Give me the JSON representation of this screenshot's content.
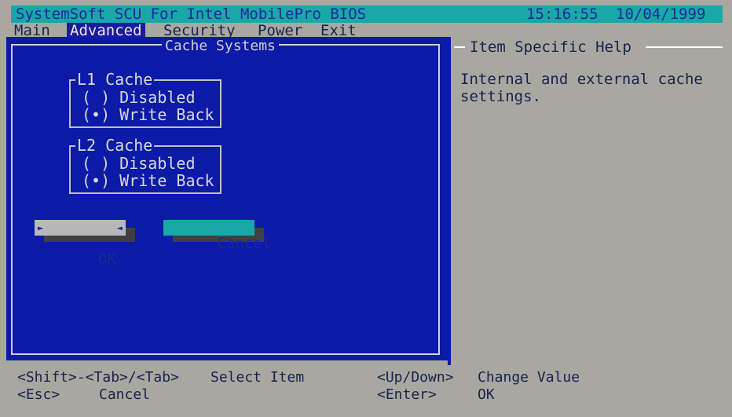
{
  "titlebar": {
    "title": "SystemSoft SCU For Intel MobilePro BIOS",
    "time": "15:16:55",
    "date": "10/04/1999"
  },
  "menu": [
    {
      "label": "Main"
    },
    {
      "label": "Advanced"
    },
    {
      "label": "Security"
    },
    {
      "label": "Power"
    },
    {
      "label": "Exit"
    }
  ],
  "dialog": {
    "title": "Cache Systems",
    "l1": {
      "title": "L1 Cache",
      "options": [
        "( ) Disabled",
        "(•) Write Back"
      ]
    },
    "l2": {
      "title": "L2 Cache",
      "options": [
        "( ) Disabled",
        "(•) Write Back"
      ]
    },
    "ok_label": "OK",
    "cancel_label": "Cancel"
  },
  "help": {
    "title": "Item Specific Help",
    "text": "Internal and external cache\nsettings."
  },
  "status": {
    "k1": "<Shift>-<Tab>/<Tab>",
    "d1": "Select Item",
    "k2": "<Esc>",
    "d2": "Cancel",
    "k3": "<Up/Down>",
    "d3": "Change Value",
    "k4": "<Enter>",
    "d4": "OK"
  }
}
